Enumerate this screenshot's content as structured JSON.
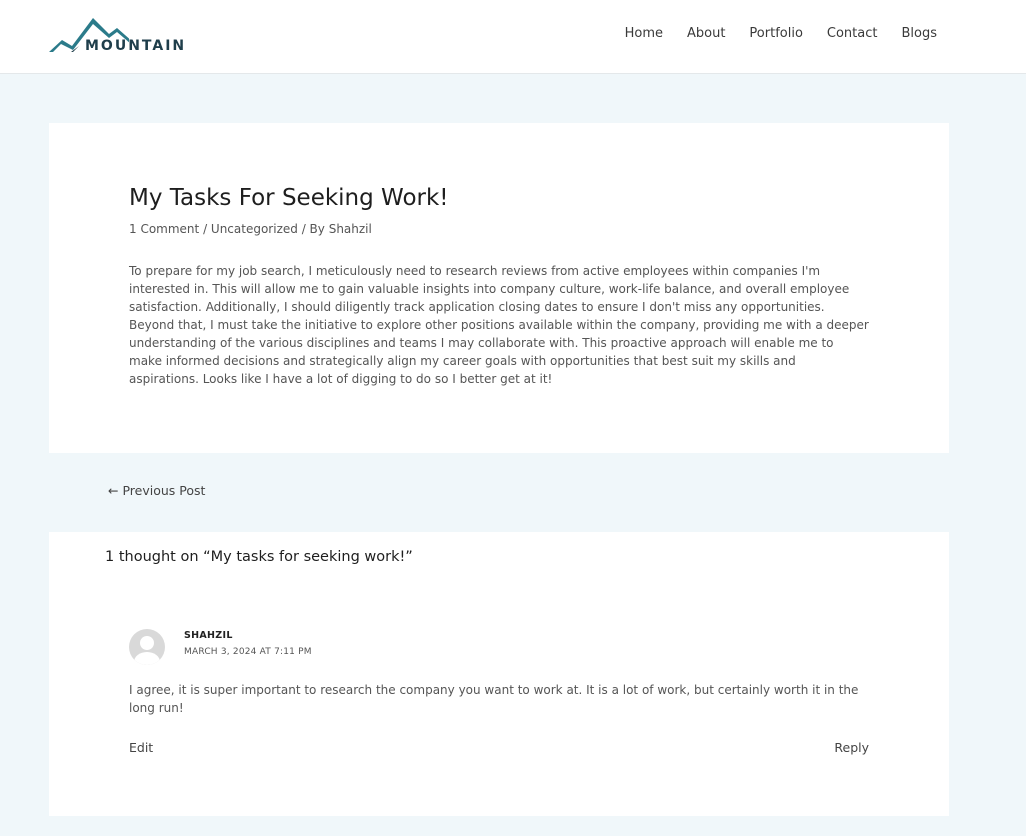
{
  "header": {
    "logo_text": "MOUNTAIN",
    "logo_icon": "mountain-logo-icon",
    "nav": [
      "Home",
      "About",
      "Portfolio",
      "Contact",
      "Blogs"
    ]
  },
  "article": {
    "title": "My Tasks For Seeking Work!",
    "meta": {
      "comments": "1 Comment",
      "sep1": " / ",
      "category": "Uncategorized",
      "by": " / By ",
      "author": "Shahzil"
    },
    "body": "To prepare for my job search, I meticulously need to research reviews from active employees within companies I'm interested in. This will allow me to gain valuable insights into company culture, work-life balance, and overall employee satisfaction. Additionally, I should diligently track application closing dates to ensure I don't miss any opportunities. Beyond that, I must take the initiative to explore other positions available within the company, providing me with a deeper understanding of the various disciplines and teams I may collaborate with. This proactive approach will enable me to make informed decisions and strategically align my career goals with opportunities that best suit my skills and aspirations. Looks like I have a lot of digging to do so I better get at it!"
  },
  "post_nav": {
    "previous": "← Previous Post"
  },
  "comments": {
    "title": "1 thought on “My tasks for seeking work!”",
    "items": [
      {
        "author": "SHAHZIL",
        "date": "MARCH 3, 2024 AT 7:11 PM",
        "text": "I agree, it is super important to research the company you want to work at. It is a lot of work, but certainly worth it in the long run!",
        "edit": "Edit",
        "reply": "Reply"
      }
    ]
  },
  "colors": {
    "page_background": "#f0f7fa",
    "logo_teal": "#2b7b8a",
    "logo_dark": "#1f3e4b"
  }
}
